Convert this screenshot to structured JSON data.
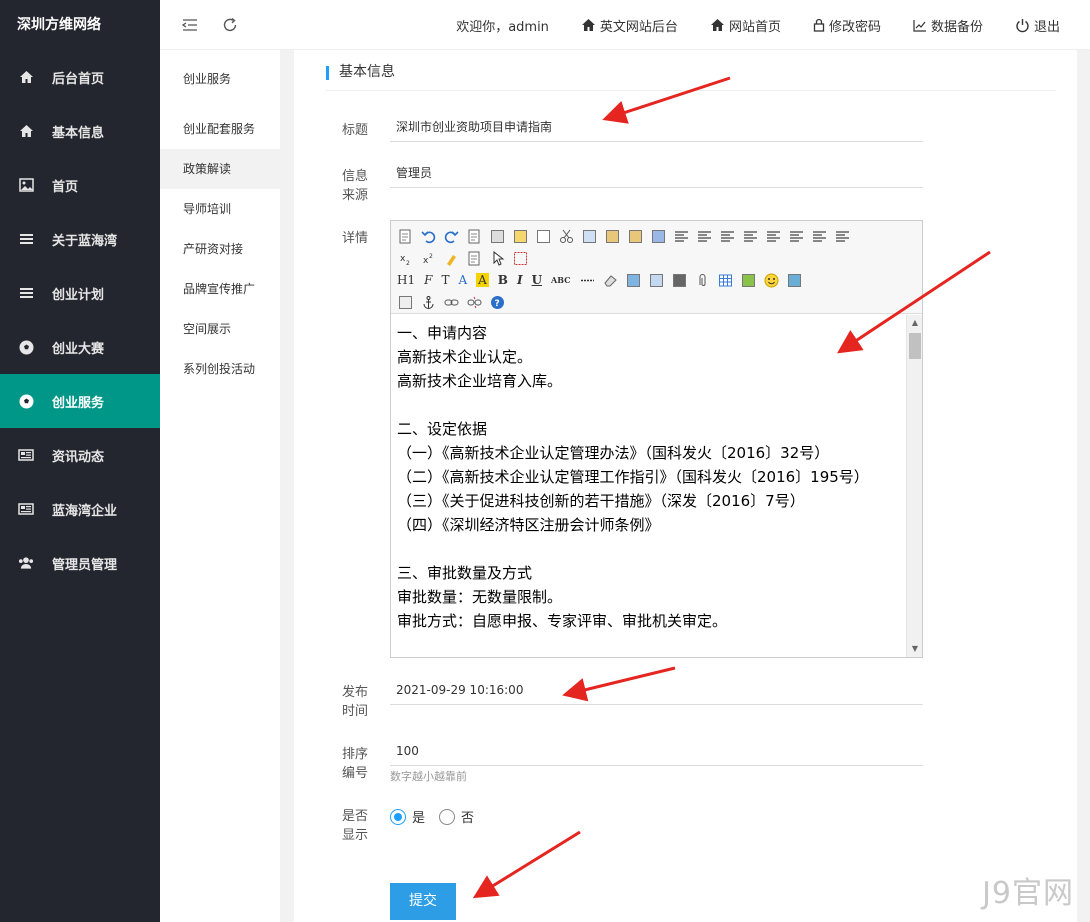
{
  "brand": "深圳方维网络",
  "sidebar": {
    "items": [
      {
        "label": "后台首页",
        "icon": "home-icon"
      },
      {
        "label": "基本信息",
        "icon": "home-icon"
      },
      {
        "label": "首页",
        "icon": "image-icon"
      },
      {
        "label": "关于蓝海湾",
        "icon": "list-icon"
      },
      {
        "label": "创业计划",
        "icon": "list-icon"
      },
      {
        "label": "创业大赛",
        "icon": "football-icon"
      },
      {
        "label": "创业服务",
        "icon": "football-icon",
        "active": true
      },
      {
        "label": "资讯动态",
        "icon": "newspaper-icon"
      },
      {
        "label": "蓝海湾企业",
        "icon": "newspaper-icon"
      },
      {
        "label": "管理员管理",
        "icon": "users-icon"
      }
    ]
  },
  "header": {
    "welcome": "欢迎你，admin",
    "links": [
      {
        "label": "英文网站后台",
        "icon": "home-icon"
      },
      {
        "label": "网站首页",
        "icon": "home-icon"
      },
      {
        "label": "修改密码",
        "icon": "lock-icon"
      },
      {
        "label": "数据备份",
        "icon": "chart-line-icon"
      },
      {
        "label": "退出",
        "icon": "power-icon"
      }
    ]
  },
  "subnav": {
    "items": [
      {
        "label": "创业服务"
      },
      {
        "label": "创业配套服务"
      },
      {
        "label": "政策解读",
        "active": true
      },
      {
        "label": "导师培训"
      },
      {
        "label": "产研资对接"
      },
      {
        "label": "品牌宣传推广"
      },
      {
        "label": "空间展示"
      },
      {
        "label": "系列创投活动"
      }
    ]
  },
  "form": {
    "section_title": "基本信息",
    "title_label": "标题",
    "title_value": "深圳市创业资助项目申请指南",
    "source_label_1": "信息",
    "source_label_2": "来源",
    "source_value": "管理员",
    "detail_label": "详情",
    "editor_lines": [
      "一、申请内容",
      "高新技术企业认定。",
      "高新技术企业培育入库。",
      "",
      "二、设定依据",
      "（一）《高新技术企业认定管理办法》（国科发火〔2016〕32号）",
      "（二）《高新技术企业认定管理工作指引》（国科发火〔2016〕195号）",
      "（三）《关于促进科技创新的若干措施》（深发〔2016〕7号）",
      "（四）《深圳经济特区注册会计师条例》",
      "",
      "三、审批数量及方式",
      "审批数量：无数量限制。",
      "审批方式：自愿申报、专家评审、审批机关审定。"
    ],
    "toolbar_text": {
      "h1": "H1",
      "font": "F",
      "size": "T",
      "color": "A",
      "bg": "A",
      "bold": "B",
      "italic": "I",
      "underline": "U",
      "strike": "ABC"
    },
    "publish_label_1": "发布",
    "publish_label_2": "时间",
    "publish_value": "2021-09-29 10:16:00",
    "sort_label_1": "排序",
    "sort_label_2": "编号",
    "sort_value": "100",
    "sort_hint": "数字越小越靠前",
    "show_label_1": "是否",
    "show_label_2": "显示",
    "show_yes": "是",
    "show_no": "否",
    "submit_label": "提交"
  },
  "watermark": "J9官网",
  "colors": {
    "sidebar_bg": "#23262e",
    "active": "#009688",
    "accent": "#1e9fff",
    "button": "#2d9ee6",
    "arrow": "#e5251f"
  }
}
